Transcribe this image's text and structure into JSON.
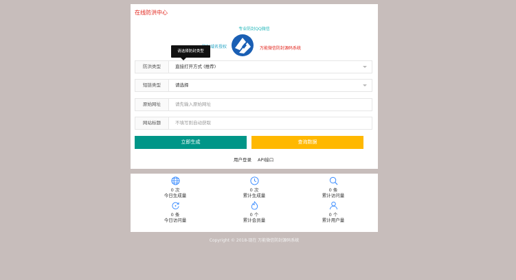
{
  "header": {
    "title": "在线防洪中心"
  },
  "links": {
    "qq": "专业防封QQ微信",
    "left_side": "防封域名授权",
    "right_side": "万能微信防封源码系统"
  },
  "tooltip": "请选择防封类型",
  "form": {
    "type_label": "防洪类型",
    "type_value": "直接打开方式 (推荐)",
    "short_label": "短链类型",
    "short_value": "请选择",
    "url_label": "原始网址",
    "url_placeholder": "请先输入原始网址",
    "title_label": "网站标题",
    "title_placeholder": "不填写则自动获取"
  },
  "buttons": {
    "generate": "立即生成",
    "query": "查询数据"
  },
  "bottom_links": {
    "user": "用户登录",
    "api": "API接口"
  },
  "stats": [
    {
      "icon": "globe-icon",
      "count": "0 次",
      "caption": "今日生成量"
    },
    {
      "icon": "clock-icon",
      "count": "0 次",
      "caption": "累计生成量"
    },
    {
      "icon": "search-icon",
      "count": "0 条",
      "caption": "累计访问量"
    },
    {
      "icon": "refresh-icon",
      "count": "0 条",
      "caption": "今日访问量"
    },
    {
      "icon": "fire-icon",
      "count": "0 个",
      "caption": "累计会员量"
    },
    {
      "icon": "user-icon",
      "count": "0 个",
      "caption": "累计用户量"
    }
  ],
  "footer": "Copyright © 2018-现在 万能微信防封源码系统",
  "colors": {
    "background": "#c7bdbb",
    "title_red": "#e2231a",
    "link_teal": "#23b7ba",
    "generate_green": "#009688",
    "query_yellow": "#ffb800",
    "icon_blue": "#3388ff"
  }
}
